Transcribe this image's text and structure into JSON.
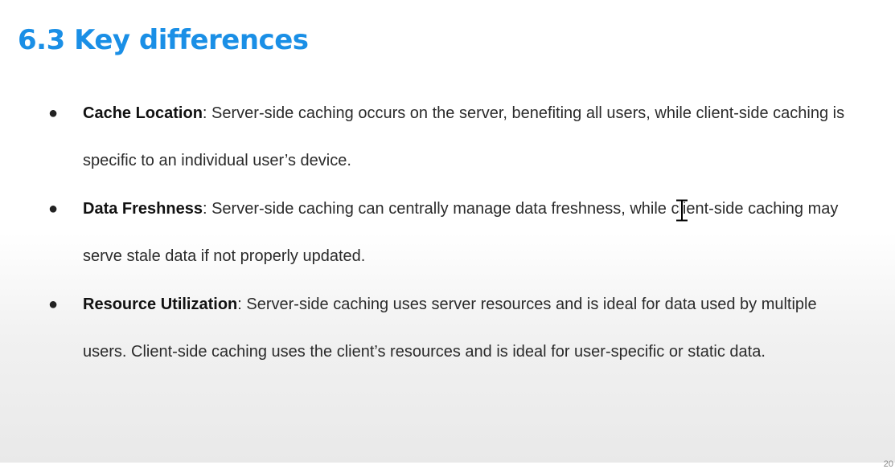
{
  "slide": {
    "title": "6.3 Key differences",
    "page_number": "20"
  },
  "bullets": [
    {
      "term": "Cache Location",
      "text": ": Server-side caching occurs on the server, benefiting all users, while client-side caching is specific to an individual user’s device."
    },
    {
      "term": "Data Freshness",
      "text": ": Server-side caching can centrally manage data freshness, while client-side caching may serve stale data if not properly updated."
    },
    {
      "term": "Resource Utilization",
      "text": ": Server-side caching uses server resources and is ideal for data used by multiple users. Client-side caching uses the client’s resources and is ideal for user-specific or static data."
    }
  ],
  "cursor": {
    "icon": "text-ibeam-cursor-icon"
  },
  "colors": {
    "title": "#1a8fe6",
    "text": "#2b2b2b"
  }
}
